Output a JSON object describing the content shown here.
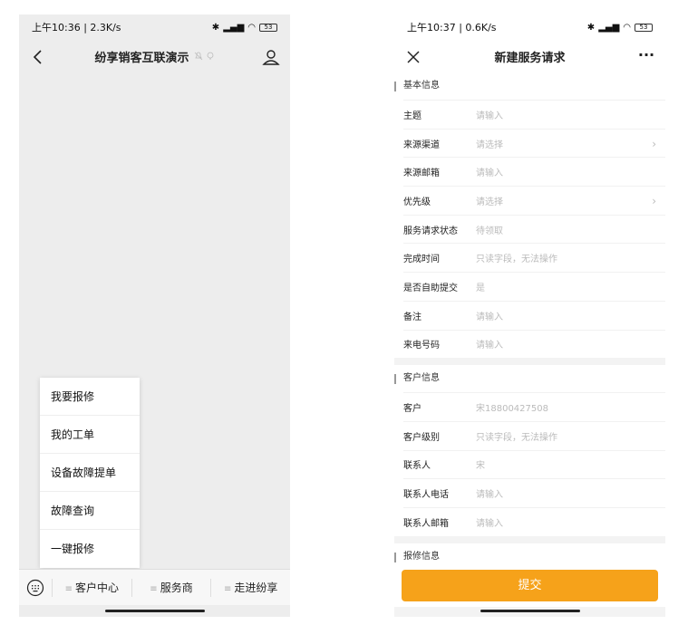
{
  "screen1": {
    "status": {
      "time": "上午10:36 | 2.3K/s",
      "signal": "ᴴᴰ",
      "battery": "53"
    },
    "nav": {
      "title": "纷享销客互联演示"
    },
    "popup_menu": [
      "我要报修",
      "我的工单",
      "设备故障提单",
      "故障查询",
      "一键报修"
    ],
    "bottom_menu": [
      "客户中心",
      "服务商",
      "走进纷享"
    ]
  },
  "screen2": {
    "status": {
      "time": "上午10:37 | 0.6K/s",
      "signal": "ᴴᴰ",
      "battery": "53"
    },
    "nav": {
      "title": "新建服务请求",
      "more": "···"
    },
    "sections": [
      {
        "title": "基本信息",
        "fields": [
          {
            "label": "主题",
            "value": "请输入"
          },
          {
            "label": "来源渠道",
            "value": "请选择"
          },
          {
            "label": "来源邮箱",
            "value": "请输入"
          },
          {
            "label": "优先级",
            "value": "请选择"
          },
          {
            "label": "服务请求状态",
            "value": "待领取"
          },
          {
            "label": "完成时间",
            "value": "只读字段，无法操作"
          },
          {
            "label": "是否自助提交",
            "value": "是"
          },
          {
            "label": "备注",
            "value": "请输入"
          },
          {
            "label": "来电号码",
            "value": "请输入"
          }
        ]
      },
      {
        "title": "客户信息",
        "fields": [
          {
            "label": "客户",
            "value": "宋18800427508"
          },
          {
            "label": "客户级别",
            "value": "只读字段，无法操作"
          },
          {
            "label": "联系人",
            "value": "宋"
          },
          {
            "label": "联系人电话",
            "value": "请输入"
          },
          {
            "label": "联系人邮箱",
            "value": "请输入"
          }
        ]
      },
      {
        "title": "报修信息",
        "fields": []
      }
    ],
    "submit_label": "提交"
  },
  "colors": {
    "accent": "#f6a21a",
    "background": "#ededed",
    "placeholder": "#bbbbbb"
  }
}
